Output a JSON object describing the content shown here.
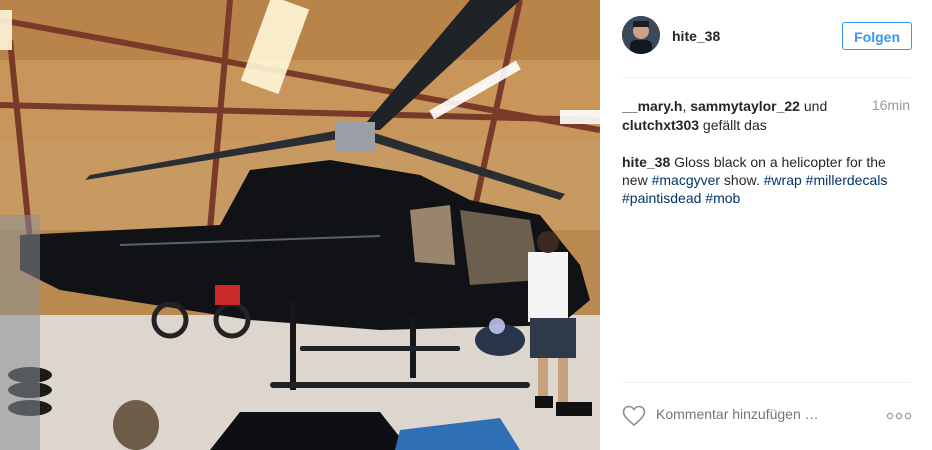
{
  "post": {
    "username": "hite_38",
    "follow_label": "Folgen",
    "timestamp": "16min",
    "likes": {
      "names": [
        "__mary.h",
        "sammytaylor_22",
        "clutchxt303"
      ],
      "separator_1": ", ",
      "conjunction": " und ",
      "suffix": " gefällt das"
    },
    "caption": {
      "author": "hite_38",
      "text_1": " Gloss black on a helicopter for the new ",
      "tag_1": "#macgyver",
      "text_2": " show. ",
      "tag_2": "#wrap",
      "tag_3": "#millerdecals",
      "tag_4": "#paintisdead",
      "tag_5": "#mob"
    },
    "comment_placeholder": "Kommentar hinzufügen …"
  },
  "icons": {
    "like": "heart-icon",
    "options": "more-options-icon"
  },
  "colors": {
    "follow_blue": "#3897f0",
    "hashtag": "#003569",
    "muted": "#999999"
  }
}
